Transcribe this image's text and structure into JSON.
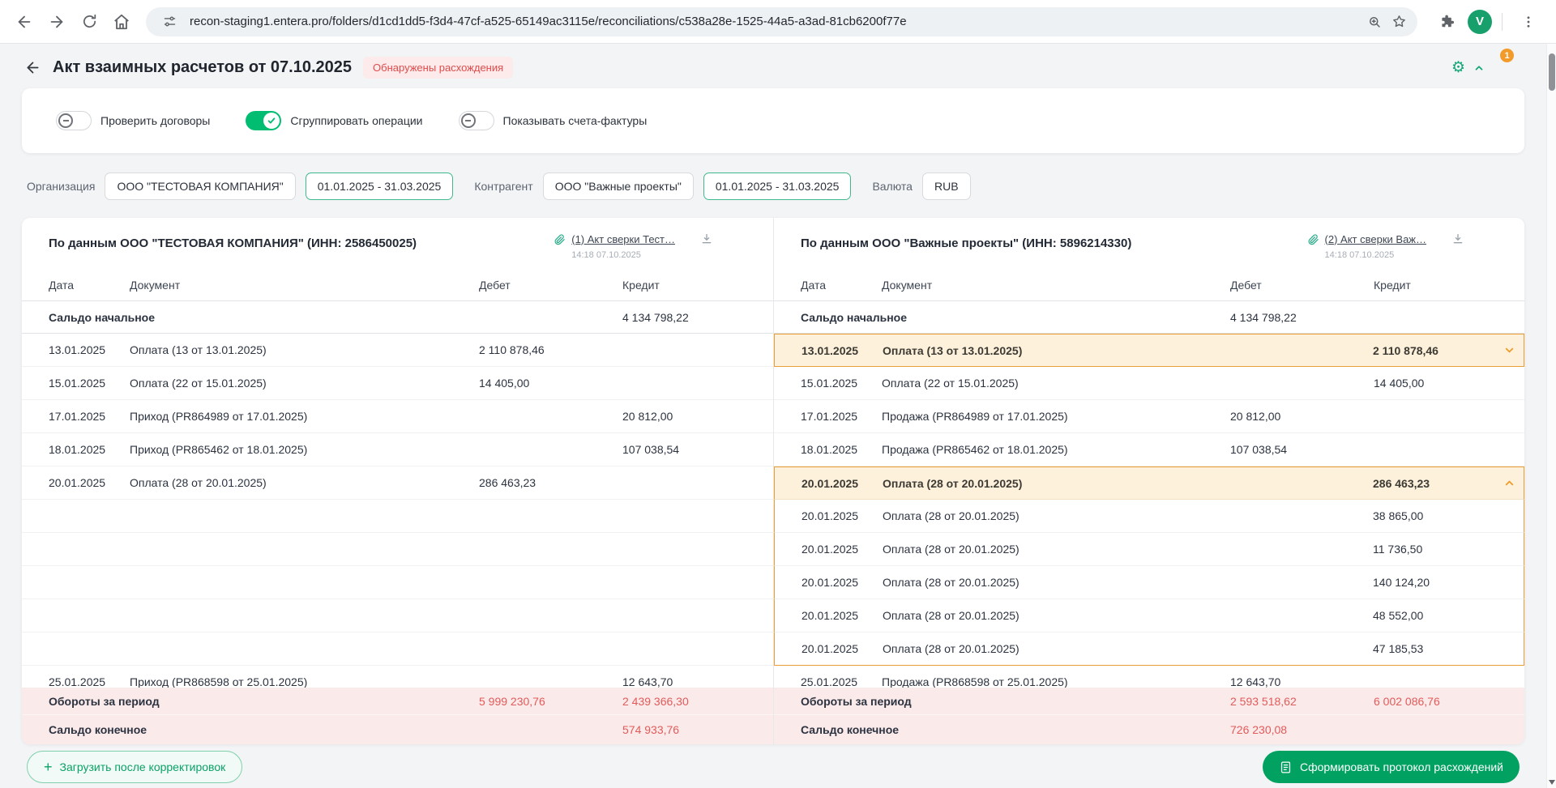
{
  "browser": {
    "url": "recon-staging1.entera.pro/folders/d1cd1dd5-f3d4-47cf-a525-65149ac3115e/reconciliations/c538a28e-1525-44a5-a3ad-81cb6200f77e",
    "profile_initial": "V"
  },
  "page": {
    "title": "Акт взаимных расчетов от 07.10.2025",
    "status_badge": "Обнаружены расхождения",
    "notification_count": "1"
  },
  "toggles": [
    {
      "label": "Проверить договоры",
      "on": false
    },
    {
      "label": "Сгруппировать операции",
      "on": true
    },
    {
      "label": "Показывать счета-фактуры",
      "on": false
    }
  ],
  "filters": {
    "organization_label": "Организация",
    "organization": "ООО \"ТЕСТОВАЯ КОМПАНИЯ\"",
    "organization_period": "01.01.2025 - 31.03.2025",
    "counterparty_label": "Контрагент",
    "counterparty": "ООО \"Важные проекты\"",
    "counterparty_period": "01.01.2025 - 31.03.2025",
    "currency_label": "Валюта",
    "currency": "RUB"
  },
  "columns": {
    "date": "Дата",
    "doc": "Документ",
    "debit": "Дебет",
    "credit": "Кредит"
  },
  "left_panel": {
    "title": "По данным ООО \"ТЕСТОВАЯ КОМПАНИЯ\" (ИНН: 2586450025)",
    "attachment_link": "(1) Акт сверки Тест…",
    "attachment_time": "14:18 07.10.2025",
    "rows": [
      {
        "type": "opening",
        "label": "Сальдо начальное",
        "debit": "",
        "credit": "4 134 798,22"
      },
      {
        "type": "normal",
        "date": "13.01.2025",
        "doc": "Оплата (13 от 13.01.2025)",
        "debit": "2 110 878,46",
        "credit": ""
      },
      {
        "type": "normal",
        "date": "15.01.2025",
        "doc": "Оплата (22 от 15.01.2025)",
        "debit": "14 405,00",
        "credit": ""
      },
      {
        "type": "normal",
        "date": "17.01.2025",
        "doc": "Приход (PR864989 от 17.01.2025)",
        "debit": "",
        "credit": "20 812,00"
      },
      {
        "type": "normal",
        "date": "18.01.2025",
        "doc": "Приход (PR865462 от 18.01.2025)",
        "debit": "",
        "credit": "107 038,54"
      },
      {
        "type": "normal",
        "date": "20.01.2025",
        "doc": "Оплата (28 от 20.01.2025)",
        "debit": "286 463,23",
        "credit": ""
      },
      {
        "type": "empty"
      },
      {
        "type": "empty"
      },
      {
        "type": "empty"
      },
      {
        "type": "empty"
      },
      {
        "type": "empty"
      },
      {
        "type": "normal",
        "date": "25.01.2025",
        "doc": "Приход (PR868598 от 25.01.2025)",
        "debit": "",
        "credit": "12 643,70"
      }
    ],
    "totals": {
      "label": "Обороты за период",
      "debit": "5 999 230,76",
      "credit": "2 439 366,30"
    },
    "closing": {
      "label": "Сальдо конечное",
      "debit": "",
      "credit": "574 933,76"
    }
  },
  "right_panel": {
    "title": "По данным ООО \"Важные проекты\" (ИНН: 5896214330)",
    "attachment_link": "(2) Акт сверки Важ…",
    "attachment_time": "14:18 07.10.2025",
    "rows": [
      {
        "type": "opening",
        "label": "Сальдо начальное",
        "debit": "4 134 798,22",
        "credit": ""
      },
      {
        "type": "group-collapsed",
        "date": "13.01.2025",
        "doc": "Оплата (13 от 13.01.2025)",
        "debit": "",
        "credit": "2 110 878,46"
      },
      {
        "type": "normal",
        "date": "15.01.2025",
        "doc": "Оплата (22 от 15.01.2025)",
        "debit": "",
        "credit": "14 405,00"
      },
      {
        "type": "normal",
        "date": "17.01.2025",
        "doc": "Продажа (PR864989 от 17.01.2025)",
        "debit": "20 812,00",
        "credit": ""
      },
      {
        "type": "normal",
        "date": "18.01.2025",
        "doc": "Продажа (PR865462 от 18.01.2025)",
        "debit": "107 038,54",
        "credit": ""
      },
      {
        "type": "group-expanded",
        "date": "20.01.2025",
        "doc": "Оплата (28 от 20.01.2025)",
        "debit": "",
        "credit": "286 463,23"
      },
      {
        "type": "sub",
        "date": "20.01.2025",
        "doc": "Оплата (28 от 20.01.2025)",
        "debit": "",
        "credit": "38 865,00"
      },
      {
        "type": "sub",
        "date": "20.01.2025",
        "doc": "Оплата (28 от 20.01.2025)",
        "debit": "",
        "credit": "11 736,50"
      },
      {
        "type": "sub",
        "date": "20.01.2025",
        "doc": "Оплата (28 от 20.01.2025)",
        "debit": "",
        "credit": "140 124,20"
      },
      {
        "type": "sub",
        "date": "20.01.2025",
        "doc": "Оплата (28 от 20.01.2025)",
        "debit": "",
        "credit": "48 552,00"
      },
      {
        "type": "sub",
        "last": true,
        "date": "20.01.2025",
        "doc": "Оплата (28 от 20.01.2025)",
        "debit": "",
        "credit": "47 185,53"
      },
      {
        "type": "normal",
        "date": "25.01.2025",
        "doc": "Продажа (PR868598 от 25.01.2025)",
        "debit": "12 643,70",
        "credit": ""
      }
    ],
    "totals": {
      "label": "Обороты за период",
      "debit": "2 593 518,62",
      "credit": "6 002 086,76"
    },
    "closing": {
      "label": "Сальдо конечное",
      "debit": "726 230,08",
      "credit": ""
    }
  },
  "footer": {
    "upload_button": "Загрузить после корректировок",
    "protocol_button": "Сформировать протокол расхождений"
  }
}
